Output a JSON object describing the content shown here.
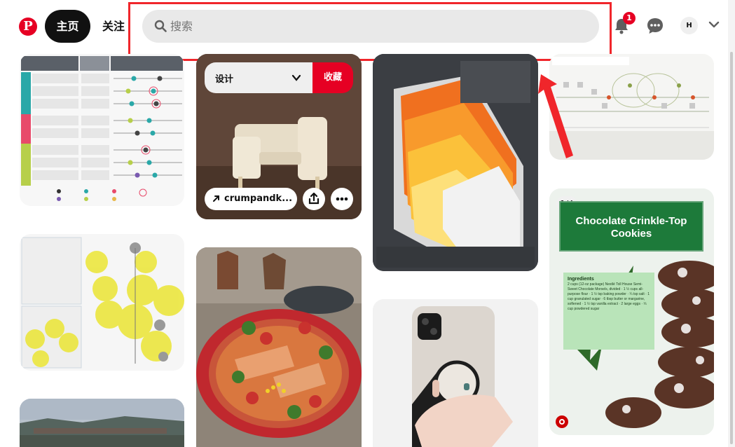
{
  "header": {
    "logo_letter": "P",
    "nav_home": "主页",
    "nav_follow": "关注",
    "search_placeholder": "搜索",
    "notification_count": "1",
    "avatar_initial": "H"
  },
  "pins": {
    "chair": {
      "board_label": "设计",
      "save_label": "收藏",
      "source_link": "crumpandk..."
    },
    "cookie": {
      "page_counter": "1/4",
      "title": "Chocolate Crinkle-Top Cookies",
      "ingredients_heading": "Ingredients",
      "ingredients_text": "2 cups (12-oz package) Nestlé Toll House Semi-Sweet Chocolate Morsels, divided · 1 ½ cups all-purpose flour · 1 ½ tsp baking powder · ¼ tsp salt · 1 cup granulated sugar · 6 tbsp butter or margarine, softened · 1 ½ tsp vanilla extract · 2 large eggs · ⅓ cup powdered sugar"
    }
  },
  "colors": {
    "brand": "#e60023",
    "highlight": "#f0262b",
    "search_bg": "#e9e9e9"
  }
}
